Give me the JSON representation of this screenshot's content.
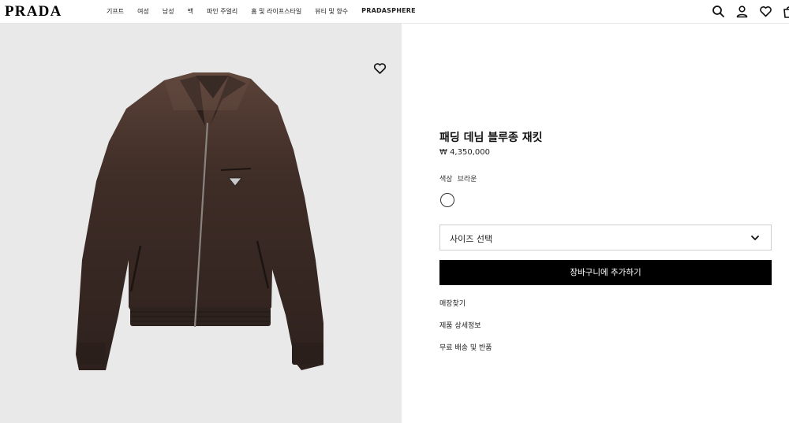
{
  "header": {
    "logo": "PRADA",
    "nav": [
      "기프트",
      "여성",
      "남성",
      "백",
      "파인 주얼리",
      "홈 및 라이프스타일",
      "뷰티 및 향수",
      "PRADASPHERE"
    ],
    "icons": [
      "search-icon",
      "account-icon",
      "wishlist-icon",
      "bag-icon"
    ]
  },
  "product": {
    "title": "패딩 데님 블루종 재킷",
    "price": "₩ 4,350,000",
    "color_label": "색상",
    "color_value": "브라운",
    "size_select": "사이즈 선택",
    "add_to_cart": "장바구니에 추가하기",
    "links": [
      "매장찾기",
      "제품 상세정보",
      "무료 배송 및 반품"
    ]
  },
  "colors": {
    "accent": "#000000",
    "image_bg": "#e9e9e9",
    "jacket": "#3b2a24"
  }
}
